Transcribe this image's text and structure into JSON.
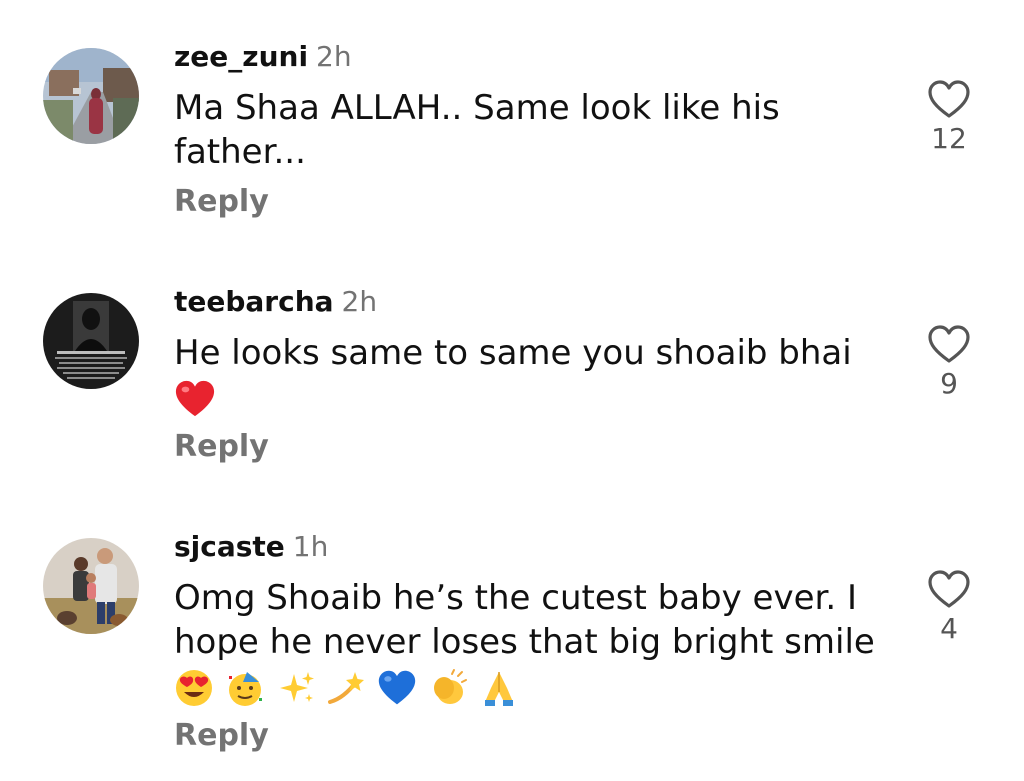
{
  "comments": [
    {
      "username": "zee_zuni",
      "time": "2h",
      "text": "Ma Shaa ALLAH.. Same look like his father...",
      "reply_label": "Reply",
      "like_count": "12",
      "avatar_icon": "street-photo-avatar"
    },
    {
      "username": "teebarcha",
      "time": "2h",
      "text": "He looks same to same you shoaib bhai",
      "emojis": [
        "red-heart"
      ],
      "reply_label": "Reply",
      "like_count": "9",
      "avatar_icon": "dark-poster-avatar"
    },
    {
      "username": "sjcaste",
      "time": "1h",
      "text": "Omg Shoaib he’s the cutest baby ever. I hope he never loses that big bright smile",
      "emojis": [
        "heart-eyes",
        "partying-face",
        "sparkles",
        "dizzy",
        "blue-heart",
        "clapping-hands",
        "folded-hands"
      ],
      "reply_label": "Reply",
      "like_count": "4",
      "avatar_icon": "family-photo-avatar"
    }
  ],
  "colors": {
    "username": "#111111",
    "secondary": "#737373",
    "heart_outline": "#555555"
  }
}
